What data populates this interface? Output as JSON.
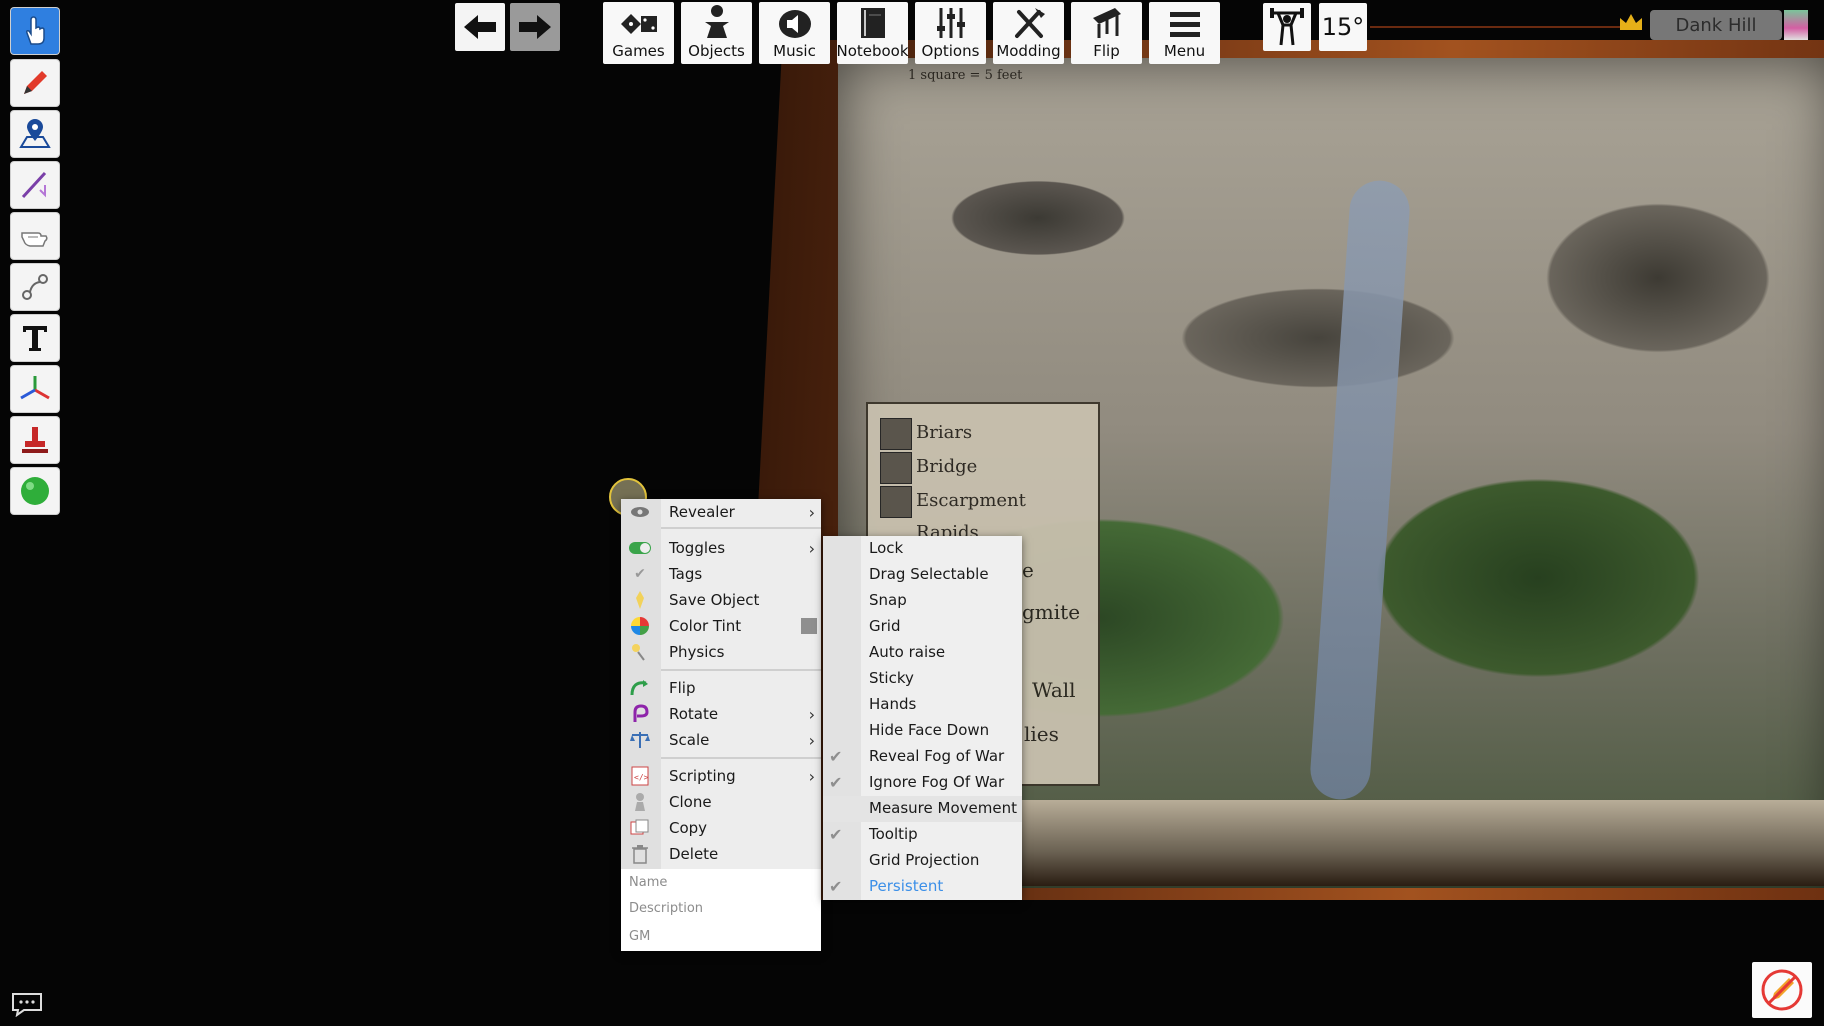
{
  "map": {
    "caption": "1 square = 5 feet",
    "legend": [
      "Briars",
      "Bridge",
      "Escarpment",
      "Rapids"
    ],
    "fragments": [
      "e",
      "gmite",
      "Wall",
      "lies"
    ]
  },
  "top_bar": {
    "buttons": [
      {
        "name": "games",
        "label": "Games",
        "icon": "dice-icon"
      },
      {
        "name": "objects",
        "label": "Objects",
        "icon": "pawn-icon"
      },
      {
        "name": "music",
        "label": "Music",
        "icon": "speaker-icon"
      },
      {
        "name": "notebook",
        "label": "Notebook",
        "icon": "notebook-icon"
      },
      {
        "name": "options",
        "label": "Options",
        "icon": "sliders-icon"
      },
      {
        "name": "modding",
        "label": "Modding",
        "icon": "tools-icon"
      },
      {
        "name": "flip",
        "label": "Flip",
        "icon": "table-flip-icon"
      },
      {
        "name": "menu",
        "label": "Menu",
        "icon": "hamburger-icon"
      }
    ],
    "rotation": "15°",
    "player_name": "Dank Hill"
  },
  "context_menu": {
    "items": [
      {
        "label": "Revealer",
        "icon": "revealer-icon",
        "submenu": true
      },
      {
        "label": "Toggles",
        "icon": "toggle-icon",
        "submenu": true
      },
      {
        "label": "Tags",
        "icon": "tag-check-icon",
        "submenu": false
      },
      {
        "label": "Save Object",
        "icon": "save-object-icon",
        "submenu": false
      },
      {
        "label": "Color Tint",
        "icon": "color-tint-icon",
        "submenu": false
      },
      {
        "label": "Physics",
        "icon": "physics-icon",
        "submenu": false
      },
      {
        "label": "Flip",
        "icon": "flip-icon",
        "submenu": false
      },
      {
        "label": "Rotate",
        "icon": "rotate-icon",
        "submenu": true
      },
      {
        "label": "Scale",
        "icon": "scale-icon",
        "submenu": true
      },
      {
        "label": "Scripting",
        "icon": "scripting-icon",
        "submenu": true
      },
      {
        "label": "Clone",
        "icon": "clone-icon",
        "submenu": false
      },
      {
        "label": "Copy",
        "icon": "copy-icon",
        "submenu": false
      },
      {
        "label": "Delete",
        "icon": "trash-icon",
        "submenu": false
      }
    ],
    "fields": {
      "name_placeholder": "Name",
      "description_placeholder": "Description",
      "gm_placeholder": "GM"
    },
    "tint_color": "#8f8f8f"
  },
  "toggles_submenu": {
    "items": [
      {
        "label": "Lock",
        "checked": false
      },
      {
        "label": "Drag Selectable",
        "checked": false
      },
      {
        "label": "Snap",
        "checked": false
      },
      {
        "label": "Grid",
        "checked": false
      },
      {
        "label": "Auto raise",
        "checked": false
      },
      {
        "label": "Sticky",
        "checked": false
      },
      {
        "label": "Hands",
        "checked": false
      },
      {
        "label": "Hide Face Down",
        "checked": false
      },
      {
        "label": "Reveal Fog of War",
        "checked": true
      },
      {
        "label": "Ignore Fog Of War",
        "checked": true
      },
      {
        "label": "Measure Movement",
        "checked": false
      },
      {
        "label": "Tooltip",
        "checked": true
      },
      {
        "label": "Grid Projection",
        "checked": false
      },
      {
        "label": "Persistent",
        "checked": true
      }
    ],
    "highlighted": "Measure Movement",
    "accent_color": "#3b8fe8"
  },
  "left_tools": [
    "grab-hand-icon",
    "pencil-icon",
    "map-pin-icon",
    "line-tool-icon",
    "flick-hand-icon",
    "joint-icon",
    "text-tool-icon",
    "gizmo-icon",
    "stamp-icon",
    "green-ball-icon"
  ]
}
